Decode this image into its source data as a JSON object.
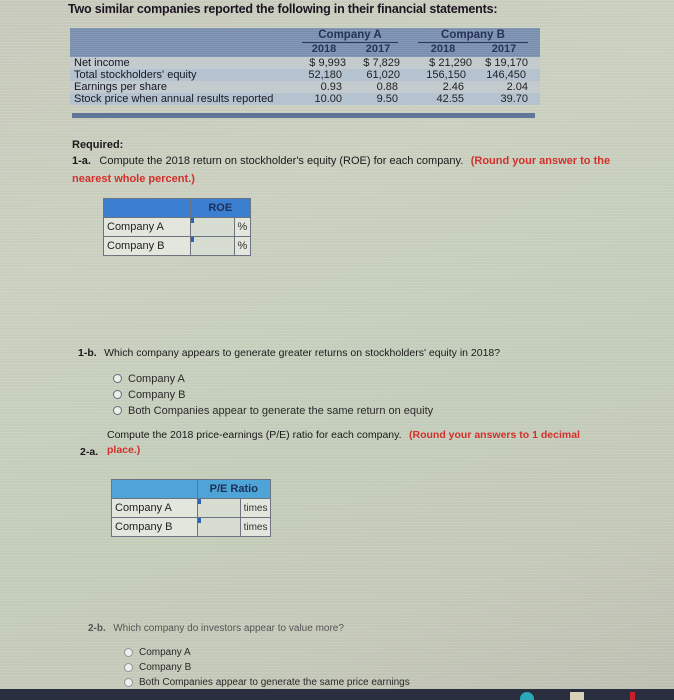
{
  "title": "Two similar companies reported the following in their financial statements:",
  "financial_table": {
    "companies": [
      {
        "name": "Company A",
        "years": [
          "2018",
          "2017"
        ]
      },
      {
        "name": "Company B",
        "years": [
          "2018",
          "2017"
        ]
      }
    ],
    "rows": [
      {
        "label": "Net income",
        "values": [
          "$ 9,993",
          "$ 7,829",
          "$ 21,290",
          "$ 19,170"
        ]
      },
      {
        "label": "Total stockholders' equity",
        "values": [
          "52,180",
          "61,020",
          "156,150",
          "146,450"
        ]
      },
      {
        "label": "Earnings per share",
        "values": [
          "0.93",
          "0.88",
          "2.46",
          "2.04"
        ]
      },
      {
        "label": "Stock price when annual results reported",
        "values": [
          "10.00",
          "9.50",
          "42.55",
          "39.70"
        ]
      }
    ]
  },
  "required_label": "Required:",
  "q1a": {
    "number": "1-a.",
    "text": "Compute the 2018 return on stockholder's equity (ROE) for each company.",
    "note": "(Round your answer to the nearest whole percent.)",
    "table": {
      "header": "ROE",
      "rows": [
        {
          "label": "Company A",
          "value": "",
          "unit": "%"
        },
        {
          "label": "Company B",
          "value": "",
          "unit": "%"
        }
      ]
    }
  },
  "q1b": {
    "number": "1-b.",
    "text": "Which company appears to generate greater returns on stockholders' equity in 2018?",
    "options": [
      "Company A",
      "Company B",
      "Both Companies appear to generate the same return on equity"
    ]
  },
  "q2a": {
    "number": "2-a.",
    "text": "Compute the 2018 price-earnings (P/E) ratio for each company.",
    "note": "(Round your answers to 1 decimal place.)",
    "table": {
      "header": "P/E Ratio",
      "rows": [
        {
          "label": "Company A",
          "value": "",
          "unit": "times"
        },
        {
          "label": "Company B",
          "value": "",
          "unit": "times"
        }
      ]
    }
  },
  "q2b": {
    "number": "2-b.",
    "text": "Which company do investors appear to value more?",
    "options": [
      "Company A",
      "Company B",
      "Both Companies appear to generate the same price earnings"
    ]
  }
}
